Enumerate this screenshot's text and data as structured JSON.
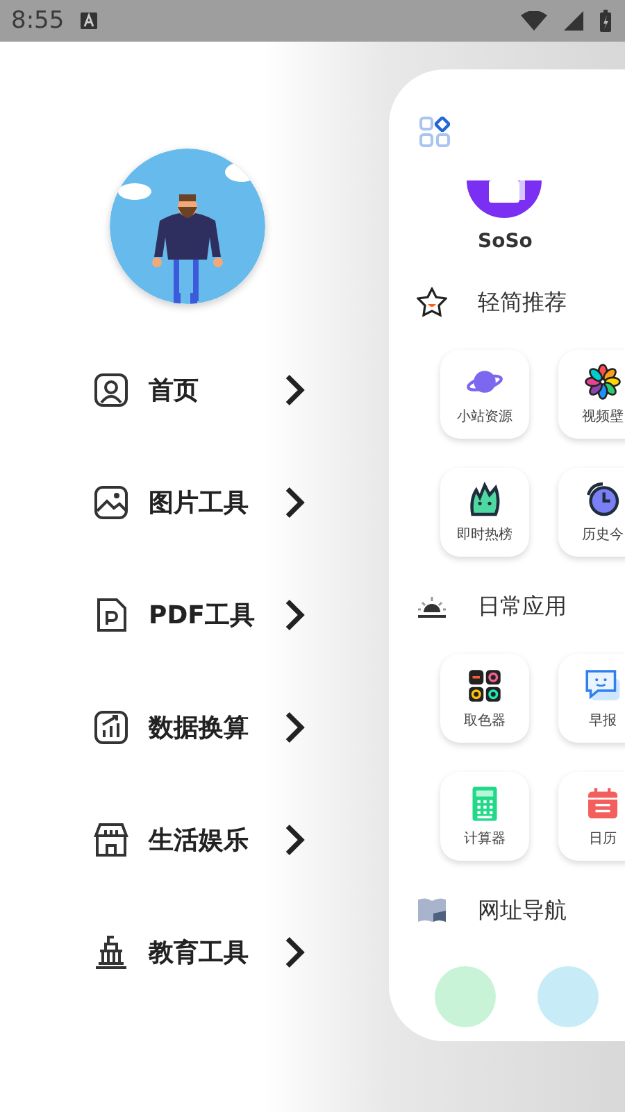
{
  "status_bar": {
    "time": "8:55"
  },
  "menu": [
    {
      "label": "首页"
    },
    {
      "label": "图片工具"
    },
    {
      "label": "PDF工具"
    },
    {
      "label": "数据换算"
    },
    {
      "label": "生活娱乐"
    },
    {
      "label": "教育工具"
    }
  ],
  "panel": {
    "top_app": {
      "label": "SoSo"
    },
    "sections": [
      {
        "title": "轻简推荐",
        "tiles": [
          {
            "label": "小站资源"
          },
          {
            "label": "视频壁"
          },
          {
            "label": "即时热榜"
          },
          {
            "label": "历史今"
          }
        ]
      },
      {
        "title": "日常应用",
        "tiles": [
          {
            "label": "取色器"
          },
          {
            "label": "早报"
          },
          {
            "label": "计算器"
          },
          {
            "label": "日历"
          }
        ]
      },
      {
        "title": "网址导航"
      }
    ]
  }
}
